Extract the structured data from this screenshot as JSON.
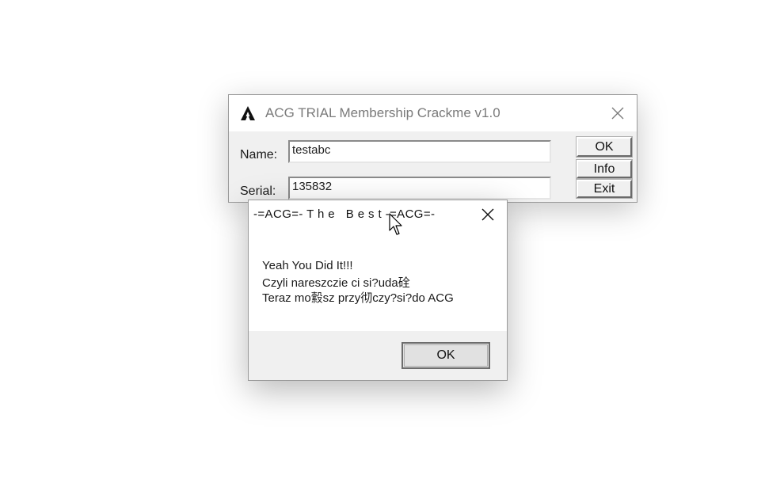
{
  "main_window": {
    "title": "ACG TRIAL Membership Crackme v1.0",
    "icon": "acg-logo-icon",
    "name_label": "Name:",
    "name_value": "testabc",
    "serial_label": "Serial:",
    "serial_value": "135832",
    "buttons": {
      "ok": "OK",
      "info": "Info",
      "exit": "Exit"
    }
  },
  "message_box": {
    "title": "-=ACG=- T h e   B e s t -=ACG=-",
    "lines": [
      "Yeah You Did It!!!",
      "Czyli nareszczie ci si?uda硂",
      "Teraz mo縠sz przy彻czy?si?do ACG"
    ],
    "ok_label": "OK"
  },
  "colors": {
    "window_bg": "#f0f0f0",
    "titlebar_bg": "#ffffff",
    "inactive_title_text": "#7a7a7a"
  }
}
